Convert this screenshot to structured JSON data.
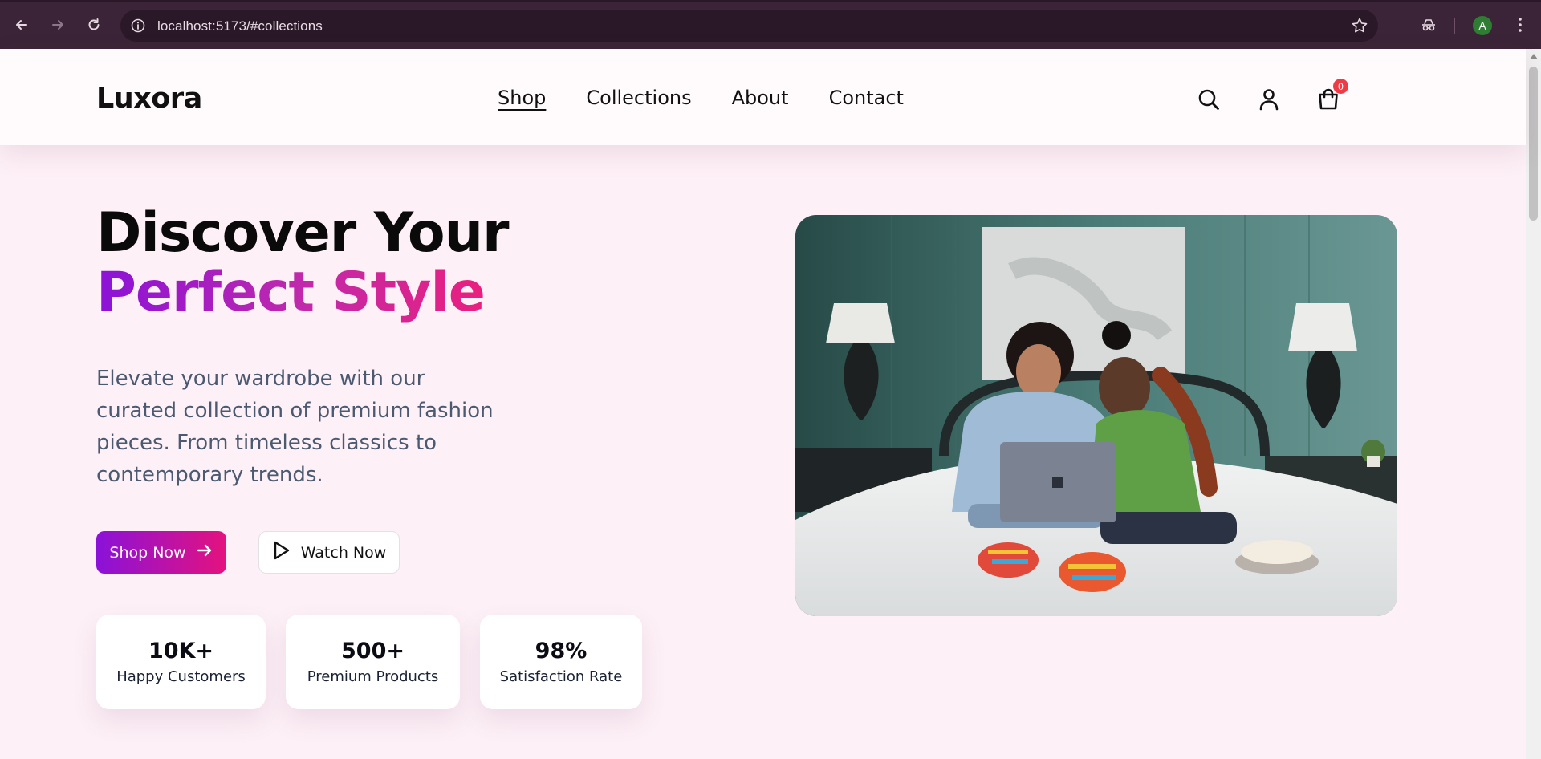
{
  "browser": {
    "url": "localhost:5173/#collections",
    "profile_initial": "A",
    "icons": [
      "back-icon",
      "forward-icon",
      "reload-icon",
      "info-icon",
      "star-icon",
      "incognito-icon",
      "menu-kebab-icon"
    ]
  },
  "site": {
    "logo": "Luxora",
    "nav": [
      {
        "label": "Shop",
        "active": true
      },
      {
        "label": "Collections",
        "active": false
      },
      {
        "label": "About",
        "active": false
      },
      {
        "label": "Contact",
        "active": false
      }
    ],
    "cart_count": "0",
    "header_icons": [
      "search-icon",
      "user-icon",
      "shopping-bag-icon"
    ]
  },
  "hero": {
    "title_line1": "Discover Your",
    "title_line2": "Perfect Style",
    "subtitle": "Elevate your wardrobe with our curated collection of premium fashion pieces. From timeless classics to contemporary trends.",
    "primary_button": "Shop Now",
    "secondary_button": "Watch Now",
    "stats": [
      {
        "value": "10K+",
        "label": "Happy Customers"
      },
      {
        "value": "500+",
        "label": "Premium Products"
      },
      {
        "value": "98%",
        "label": "Satisfaction Rate"
      }
    ]
  },
  "colors": {
    "gradient_start": "#8b12d8",
    "gradient_end": "#ea1f7e",
    "page_bg": "#fdf0f6",
    "browser_bg": "#3b2437",
    "badge": "#ef3b46"
  }
}
